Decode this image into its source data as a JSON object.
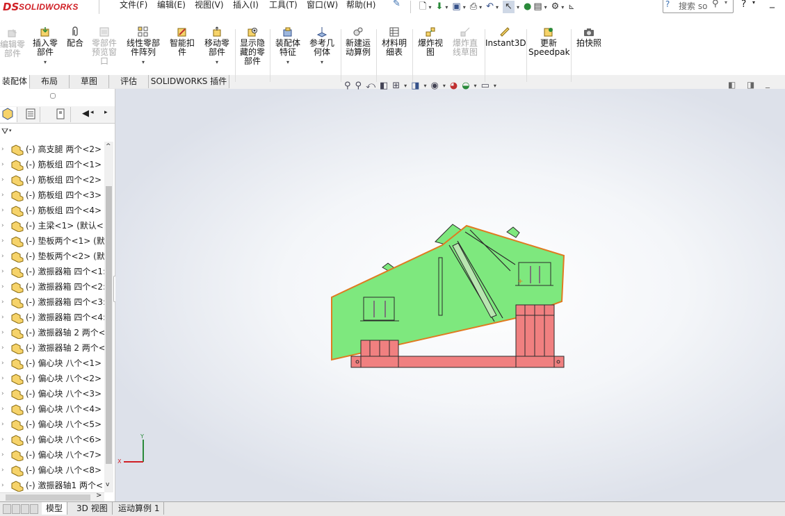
{
  "app": {
    "logo_mark": "DS",
    "logo_text": "SOLIDWORKS",
    "brand_color": "#d01f25"
  },
  "menu": [
    "文件(F)",
    "编辑(E)",
    "视图(V)",
    "插入(I)",
    "工具(T)",
    "窗口(W)",
    "帮助(H)"
  ],
  "search": {
    "placeholder": "搜索 so"
  },
  "commands": [
    {
      "label": "编辑零\n部件",
      "disabled": true
    },
    {
      "label": "插入零\n部件",
      "disabled": false
    },
    {
      "label": "配合",
      "disabled": false
    },
    {
      "label": "零部件\n预览窗\n口",
      "disabled": true
    },
    {
      "label": "线性零部\n件阵列",
      "disabled": false
    },
    {
      "label": "智能扣\n件",
      "disabled": false
    },
    {
      "label": "移动零\n部件",
      "disabled": false
    },
    {
      "label": "显示隐\n藏的零\n部件",
      "disabled": false
    },
    {
      "label": "装配体\n特征",
      "disabled": false
    },
    {
      "label": "参考几\n何体",
      "disabled": false
    },
    {
      "label": "新建运\n动算例",
      "disabled": false
    },
    {
      "label": "材料明\n细表",
      "disabled": false
    },
    {
      "label": "爆炸视\n图",
      "disabled": false
    },
    {
      "label": "爆炸直\n线草图",
      "disabled": true
    },
    {
      "label": "Instant3D",
      "disabled": false
    },
    {
      "label": "更新\nSpeedpak",
      "disabled": false
    },
    {
      "label": "拍快照",
      "disabled": false
    }
  ],
  "tabs": [
    "装配体",
    "布局",
    "草图",
    "评估",
    "SOLIDWORKS 插件"
  ],
  "tree": [
    "(-) 高支腿   两个<2>",
    "(-) 筋板组  四个<1>",
    "(-) 筋板组  四个<2>",
    "(-) 筋板组  四个<3>",
    "(-) 筋板组  四个<4>",
    "(-) 主梁<1> (默认<<",
    "(-) 垫板两个<1> (默",
    "(-) 垫板两个<2> (默",
    "(-) 激振器箱 四个<1:",
    "(-) 激振器箱 四个<2:",
    "(-) 激振器箱 四个<3:",
    "(-) 激振器箱 四个<4:",
    "(-) 激振器轴 2  两个<",
    "(-) 激振器轴 2  两个<",
    "(-) 偏心块  八个<1>",
    "(-) 偏心块  八个<2>",
    "(-) 偏心块  八个<3>",
    "(-) 偏心块  八个<4>",
    "(-) 偏心块  八个<5>",
    "(-) 偏心块  八个<6>",
    "(-) 偏心块  八个<7>",
    "(-) 偏心块  八个<8>",
    "(-) 激振器轴1  两个<"
  ],
  "bottom_tabs": [
    "模型",
    "3D 视图",
    "运动算例 1"
  ],
  "triad": {
    "x": "X",
    "y": "Y"
  },
  "colors": {
    "body_green": "#7ee87e",
    "base_red": "#f08080",
    "edge_orange": "#e07a20"
  }
}
